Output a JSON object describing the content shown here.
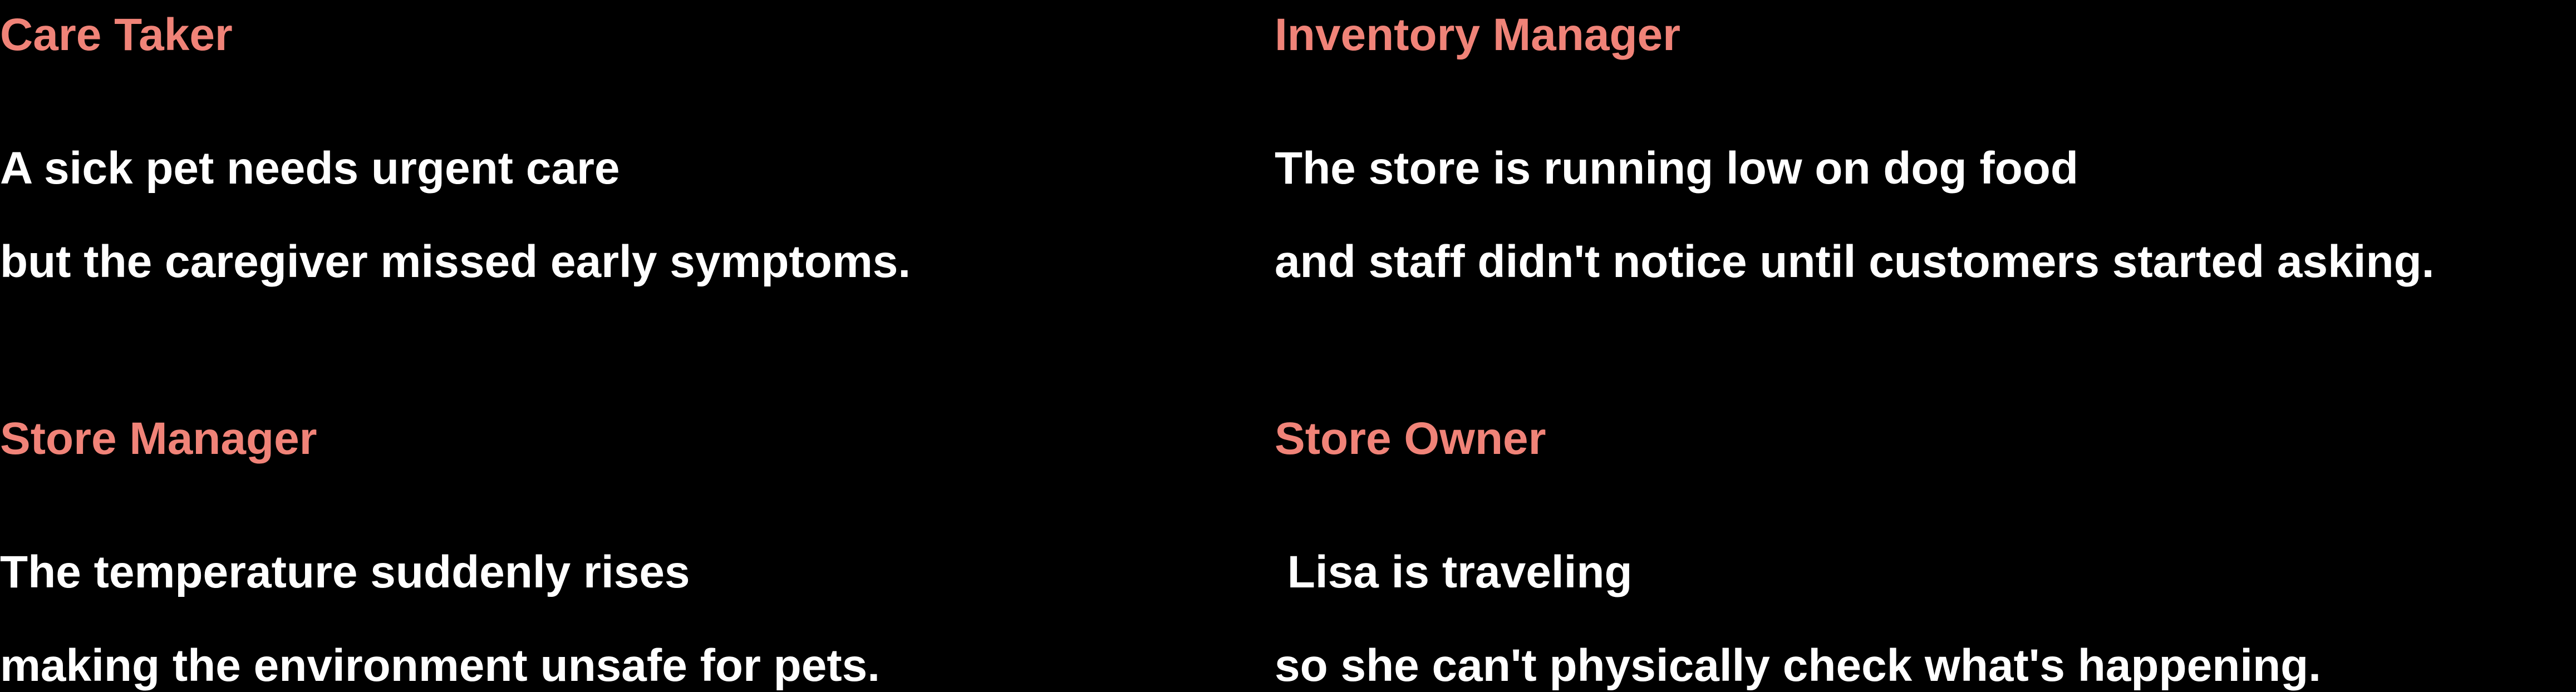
{
  "colors": {
    "background": "#000000",
    "role_accent": "#f08378",
    "body_text": "#ffffff"
  },
  "scenarios": [
    {
      "role": "Care Taker",
      "line1": "A sick pet needs urgent care",
      "line2": "but the caregiver missed early symptoms."
    },
    {
      "role": "Inventory Manager",
      "line1": "The store is running low on dog food",
      "line2": "and staff didn't notice until customers started asking."
    },
    {
      "role": "Store Manager",
      "line1": "The temperature suddenly rises",
      "line2": "making the environment unsafe for pets."
    },
    {
      "role": "Store Owner",
      "line1": " Lisa is traveling",
      "line2": "so she can't physically check what's happening."
    }
  ]
}
